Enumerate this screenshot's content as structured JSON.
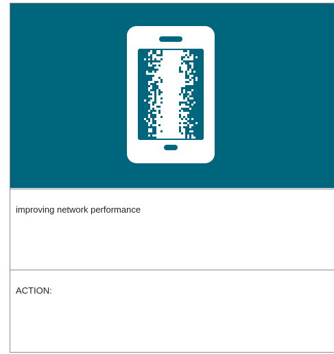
{
  "card": {
    "description": "improving network performance",
    "action_label": "ACTION:"
  },
  "hero": {
    "icon": "smartphone-signal-icon",
    "background_color": "#00667d",
    "icon_color": "#ffffff"
  }
}
